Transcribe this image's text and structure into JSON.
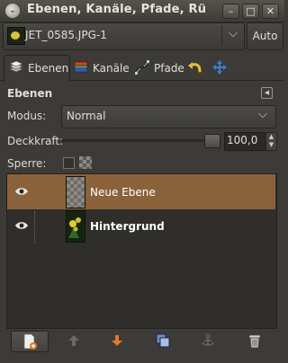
{
  "window": {
    "title": "Ebenen, Kanäle, Pfade, Rü",
    "buttons": {
      "menu": "⌄",
      "minimize": "–",
      "maximize": "□",
      "close": "✕"
    }
  },
  "image_selector": {
    "value": "JET_0585.JPG-1",
    "auto_label": "Auto"
  },
  "tabs": [
    {
      "label": "Ebenen",
      "icon": "layers-icon"
    },
    {
      "label": "Kanäle",
      "icon": "channels-icon"
    },
    {
      "label": "Pfade",
      "icon": "paths-icon"
    },
    {
      "label": "",
      "icon": "undo-history-icon"
    },
    {
      "label": "",
      "icon": "move-navigation-icon"
    }
  ],
  "panel": {
    "title": "Ebenen",
    "mode_label": "Modus:",
    "mode_value": "Normal",
    "opacity_label": "Deckkraft:",
    "opacity_value": "100,0",
    "opacity_fraction": 1.0,
    "lock_label": "Sperre:"
  },
  "layers": [
    {
      "name": "Neue Ebene",
      "selected": true,
      "visible": true
    },
    {
      "name": "Hintergrund",
      "selected": false,
      "visible": true
    }
  ],
  "toolbar": {
    "buttons": [
      "new-layer-icon",
      "raise-layer-icon",
      "lower-layer-icon",
      "duplicate-layer-icon",
      "anchor-layer-icon",
      "delete-layer-icon"
    ]
  },
  "colors": {
    "background": "#3c3b37",
    "selection": "#8a633b",
    "list_background": "#2f2e2b",
    "accent_orange": "#e8781e"
  }
}
